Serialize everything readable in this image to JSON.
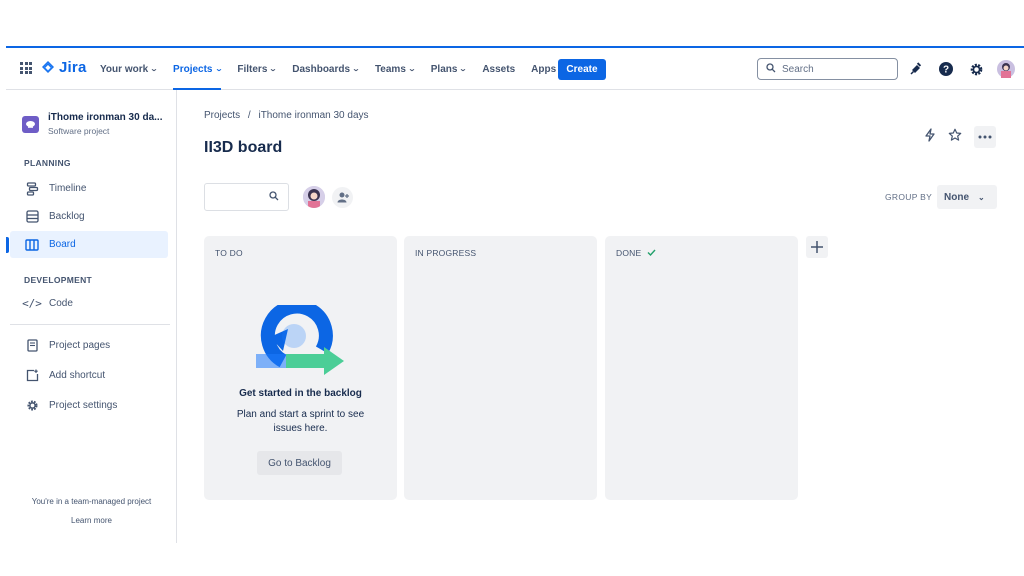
{
  "topnav": {
    "logo_text": "Jira",
    "items": [
      {
        "label": "Your work",
        "dropdown": true
      },
      {
        "label": "Projects",
        "dropdown": true,
        "active": true
      },
      {
        "label": "Filters",
        "dropdown": true
      },
      {
        "label": "Dashboards",
        "dropdown": true
      },
      {
        "label": "Teams",
        "dropdown": true
      },
      {
        "label": "Plans",
        "dropdown": true
      },
      {
        "label": "Assets",
        "dropdown": false
      },
      {
        "label": "Apps",
        "dropdown": true
      }
    ],
    "create_label": "Create",
    "search_placeholder": "Search",
    "icons": [
      "notifications-icon",
      "help-icon",
      "settings-icon",
      "profile-avatar"
    ]
  },
  "sidebar": {
    "project_name": "iThome ironman 30 da...",
    "project_type": "Software project",
    "planning_title": "PLANNING",
    "planning_items": [
      {
        "label": "Timeline",
        "icon": "timeline-icon"
      },
      {
        "label": "Backlog",
        "icon": "backlog-icon"
      },
      {
        "label": "Board",
        "icon": "board-icon",
        "active": true
      }
    ],
    "development_title": "DEVELOPMENT",
    "development_items": [
      {
        "label": "Code",
        "icon": "code-icon"
      }
    ],
    "other_items": [
      {
        "label": "Project pages",
        "icon": "page-icon"
      },
      {
        "label": "Add shortcut",
        "icon": "add-shortcut-icon"
      },
      {
        "label": "Project settings",
        "icon": "gear-icon"
      }
    ],
    "footer_text": "You're in a team-managed project",
    "learn_more": "Learn more"
  },
  "main": {
    "breadcrumbs": [
      "Projects",
      "/",
      "iThome ironman 30 days"
    ],
    "title": "II3D board",
    "group_by_label": "GROUP BY",
    "group_by_value": "None",
    "columns": [
      {
        "title": "TO DO",
        "done_check": false
      },
      {
        "title": "IN PROGRESS",
        "done_check": false
      },
      {
        "title": "DONE",
        "done_check": true
      }
    ],
    "empty_state": {
      "heading": "Get started in the backlog",
      "body": "Plan and start a sprint to see issues here.",
      "button": "Go to Backlog"
    }
  },
  "colors": {
    "accent": "#0c66e4",
    "column_bg": "#f1f2f4",
    "done_check": "#22a06b"
  }
}
